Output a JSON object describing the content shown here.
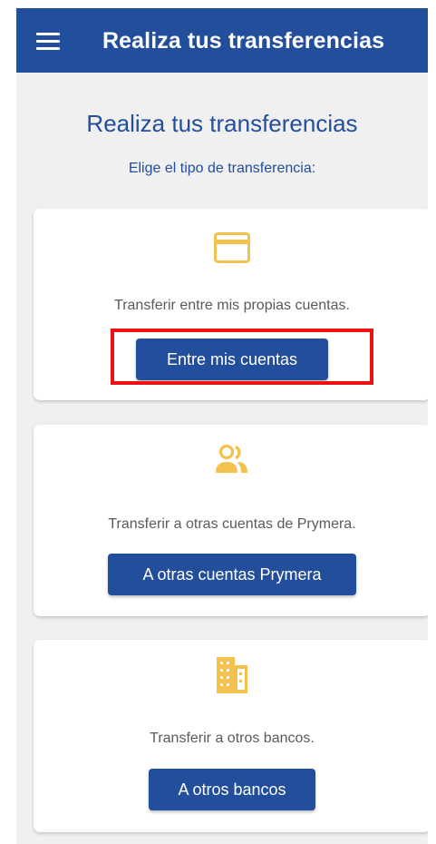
{
  "app_bar": {
    "title": "Realiza tus transferencias",
    "menu_icon": "hamburger-menu-icon",
    "background_color": "#234e9c"
  },
  "main": {
    "title": "Realiza tus transferencias",
    "subtitle": "Elige el tipo de transferencia:"
  },
  "cards": [
    {
      "icon": "credit-card-icon",
      "description": "Transferir entre mis propias cuentas.",
      "button_label": "Entre mis cuentas"
    },
    {
      "icon": "people-icon",
      "description": "Transferir a otras cuentas de Prymera.",
      "button_label": "A otras cuentas Prymera"
    },
    {
      "icon": "building-icon",
      "description": "Transferir a otros bancos.",
      "button_label": "A otros bancos"
    }
  ],
  "colors": {
    "primary": "#234e9c",
    "icon_accent": "#f2c14e",
    "highlight": "#ee1111",
    "screen_background": "#f0f0f0"
  }
}
